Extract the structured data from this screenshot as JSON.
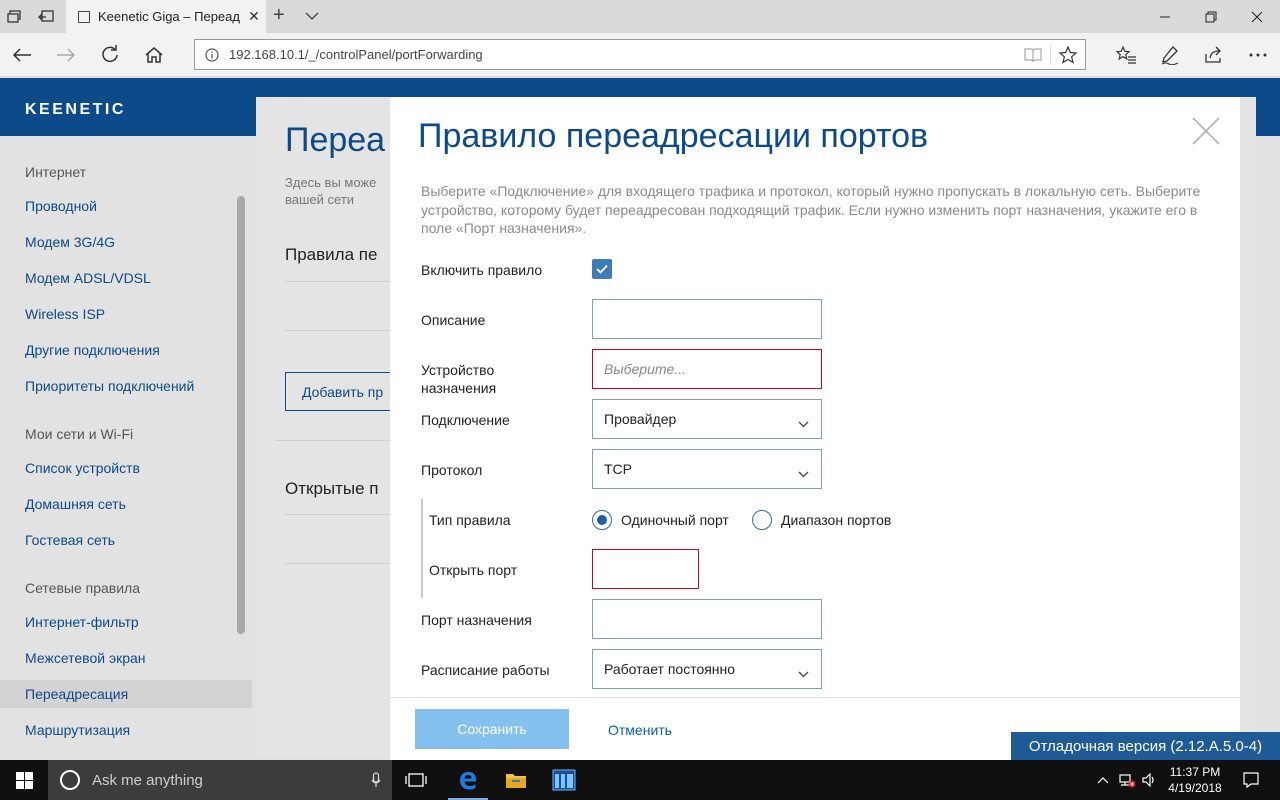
{
  "browser": {
    "tab_title": "Keenetic Giga – Переад",
    "url": "192.168.10.1/_/controlPanel/portForwarding"
  },
  "app": {
    "logo": "KEENETIC"
  },
  "sidebar": {
    "sections": [
      {
        "title": "Интернет"
      },
      {
        "title": "Мои сети и Wi-Fi"
      },
      {
        "title": "Сетевые правила"
      }
    ],
    "items": [
      {
        "label": "Проводной"
      },
      {
        "label": "Модем 3G/4G"
      },
      {
        "label": "Модем ADSL/VDSL"
      },
      {
        "label": "Wireless ISP"
      },
      {
        "label": "Другие подключения"
      },
      {
        "label": "Приоритеты подключений"
      },
      {
        "label": "Список устройств"
      },
      {
        "label": "Домашняя сеть"
      },
      {
        "label": "Гостевая сеть"
      },
      {
        "label": "Интернет-фильтр"
      },
      {
        "label": "Межсетевой экран"
      },
      {
        "label": "Переадресация"
      },
      {
        "label": "Маршрутизация"
      }
    ]
  },
  "background_page": {
    "title": "Переа",
    "lead": "Здесь вы може вашей сети",
    "section1": "Правила пе",
    "add_button": "Добавить пр",
    "section2": "Открытые п"
  },
  "modal": {
    "title": "Правило переадресации портов",
    "description": "Выберите «Подключение» для входящего трафика и протокол, который нужно пропускать в локальную сеть. Выберите устройство, которому будет переадресован подходящий трафик. Если нужно изменить порт назначения, укажите его в поле «Порт назначения».",
    "fields": {
      "enable_label": "Включить правило",
      "description_label": "Описание",
      "description_value": "",
      "device_label": "Устройство назначения",
      "device_placeholder": "Выберите...",
      "connection_label": "Подключение",
      "connection_value": "Провайдер",
      "protocol_label": "Протокол",
      "protocol_value": "TCP",
      "rule_type_label": "Тип правила",
      "rule_type_single": "Одиночный порт",
      "rule_type_range": "Диапазон портов",
      "open_port_label": "Открыть порт",
      "dest_port_label": "Порт назначения",
      "schedule_label": "Расписание работы",
      "schedule_value": "Работает постоянно"
    },
    "save_label": "Сохранить",
    "cancel_label": "Отменить"
  },
  "debug_badge": "Отладочная версия (2.12.A.5.0-4)",
  "taskbar": {
    "search_placeholder": "Ask me anything",
    "time": "11:37 PM",
    "date": "4/19/2018"
  },
  "colors": {
    "brand": "#0c4a8a",
    "accent": "#3e7bb9",
    "error": "#d0021b",
    "save_disabled": "#85c1ef"
  }
}
